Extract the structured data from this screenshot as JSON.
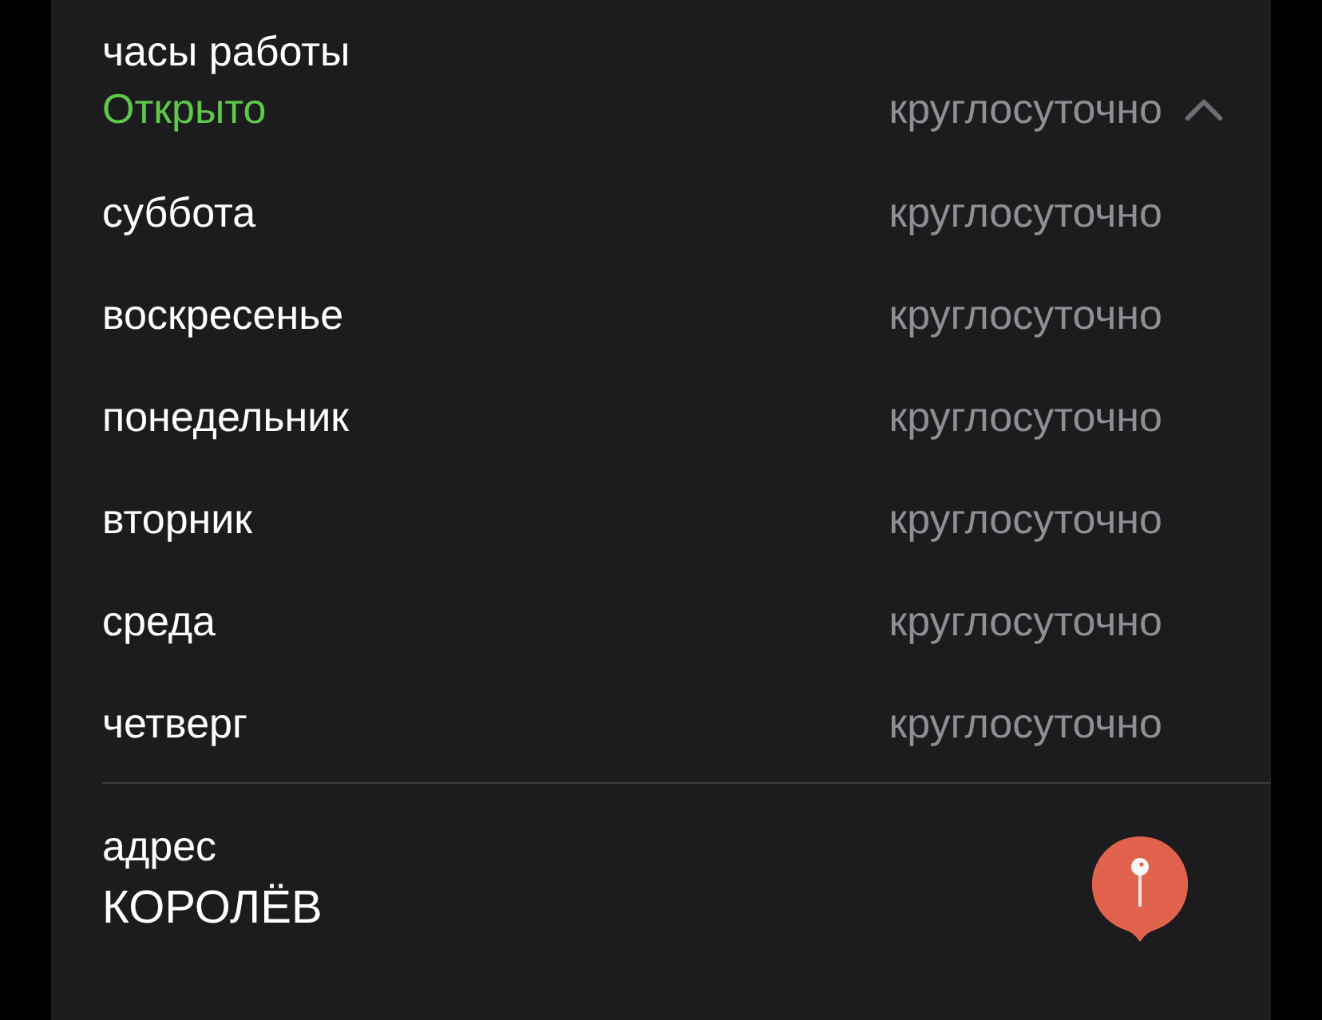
{
  "hours": {
    "label": "часы работы",
    "status": "Открыто",
    "status_time": "круглосуточно",
    "expanded": true,
    "days": [
      {
        "day": "суббота",
        "time": "круглосуточно"
      },
      {
        "day": "воскресенье",
        "time": "круглосуточно"
      },
      {
        "day": "понедельник",
        "time": "круглосуточно"
      },
      {
        "day": "вторник",
        "time": "круглосуточно"
      },
      {
        "day": "среда",
        "time": "круглосуточно"
      },
      {
        "day": "четверг",
        "time": "круглосуточно"
      }
    ]
  },
  "address": {
    "label": "адрес",
    "value": "КОРОЛЁВ"
  }
}
